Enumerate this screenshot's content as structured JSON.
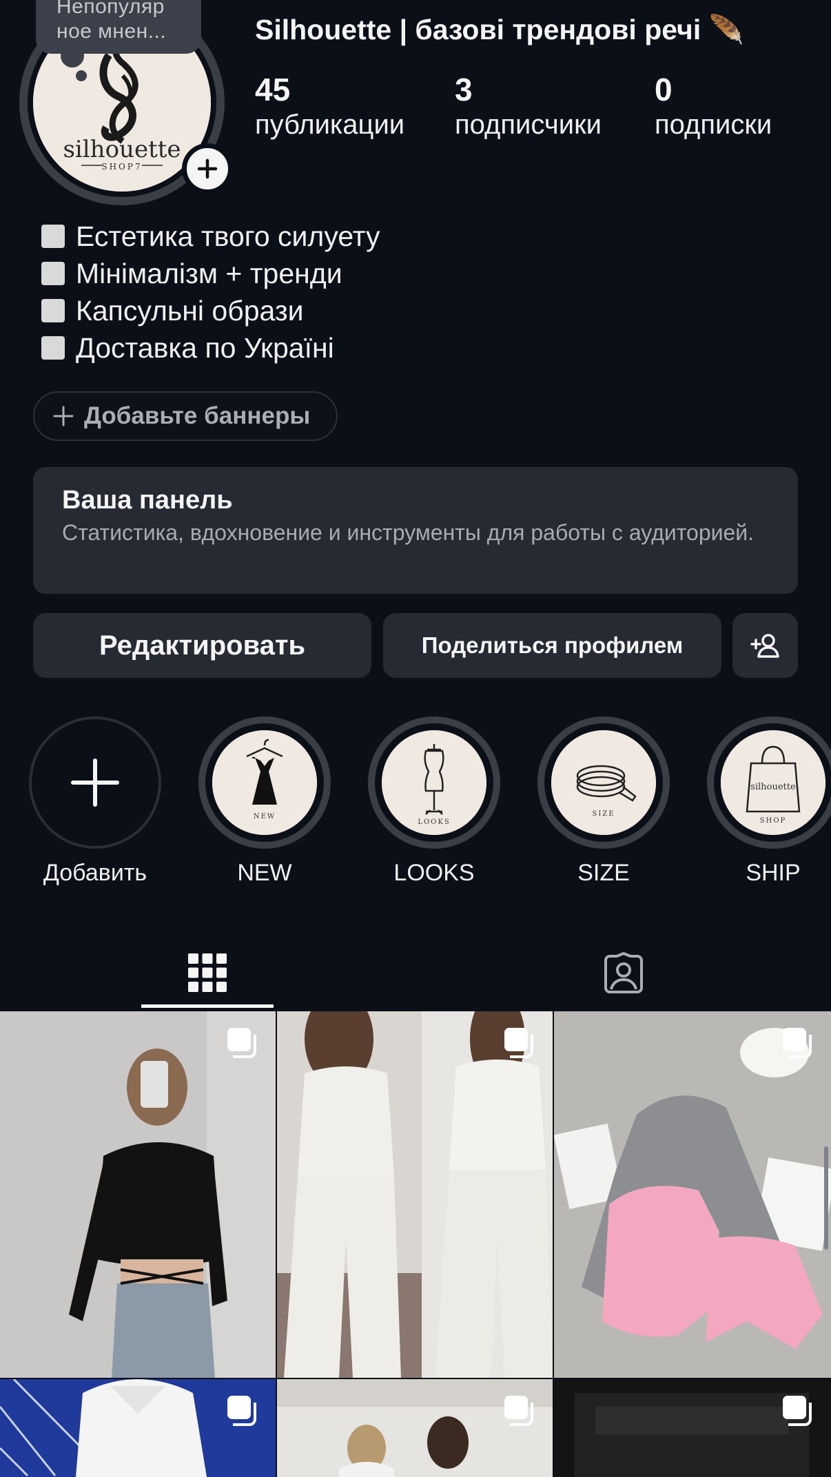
{
  "profile": {
    "note": "Непопуляр ное мнен...",
    "name": "Silhouette | базові трендові речі 🪶",
    "avatar_text": "silhouette",
    "avatar_subtext": "SHOP7",
    "stats": [
      {
        "value": "45",
        "label": "публикации"
      },
      {
        "value": "3",
        "label": "подписчики"
      },
      {
        "value": "0",
        "label": "подписки"
      }
    ]
  },
  "bio": [
    "Естетика твого силуету",
    "Мінімалізм + тренди",
    "Капсульні образи",
    "Доставка по Україні"
  ],
  "banner_button": "Добавьте баннеры",
  "panel": {
    "title": "Ваша панель",
    "description": "Статистика, вдохновение и инструменты для работы с аудиторией."
  },
  "actions": {
    "edit": "Редактировать",
    "share": "Поделиться профилем"
  },
  "highlights": [
    {
      "label": "Добавить",
      "icon": "plus-icon",
      "caption": ""
    },
    {
      "label": "NEW",
      "icon": "dress-hanger-icon",
      "caption": "NEW"
    },
    {
      "label": "LOOKS",
      "icon": "mannequin-icon",
      "caption": "LOOKS"
    },
    {
      "label": "SIZE",
      "icon": "measuring-tape-icon",
      "caption": "SIZE"
    },
    {
      "label": "SHIP",
      "icon": "shopping-bag-icon",
      "caption": "SHOP"
    }
  ],
  "tabs": [
    {
      "name": "grid-icon",
      "active": true
    },
    {
      "name": "tagged-icon",
      "active": false
    }
  ],
  "colors": {
    "background": "#0b0f18",
    "card": "#262a33",
    "ring": "#3a3e47",
    "text": "#f5f5f5",
    "muted": "#a7abb3"
  }
}
